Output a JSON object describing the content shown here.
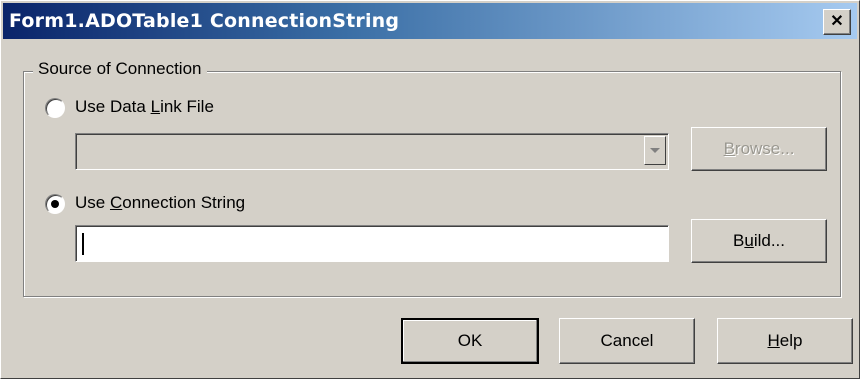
{
  "window": {
    "title": "Form1.ADOTable1 ConnectionString",
    "close_glyph": "✕"
  },
  "source_group": {
    "title": "Source of Connection",
    "data_link_option": {
      "pre": "Use Data ",
      "key": "L",
      "post": "ink File",
      "selected": false
    },
    "data_link_file": {
      "value": ""
    },
    "browse_button": {
      "pre": "",
      "key": "B",
      "post": "rowse...",
      "enabled": false
    },
    "connection_string_option": {
      "pre": "Use ",
      "key": "C",
      "post": "onnection String",
      "selected": true
    },
    "connection_string": {
      "value": ""
    },
    "build_button": {
      "pre": "B",
      "key": "u",
      "post": "ild...",
      "enabled": true
    }
  },
  "footer": {
    "ok_label": "OK",
    "cancel_label": "Cancel",
    "help_button": {
      "pre": "",
      "key": "H",
      "post": "elp"
    }
  }
}
